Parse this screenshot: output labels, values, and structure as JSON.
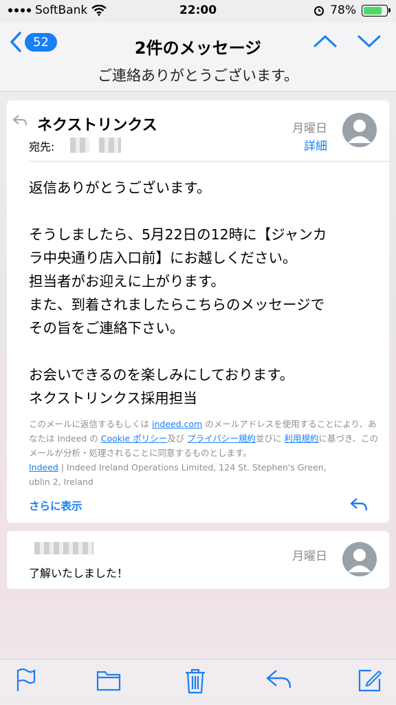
{
  "status": {
    "carrier": "SoftBank",
    "time": "22:00",
    "battery": "78%",
    "battery_level": 0.78
  },
  "nav": {
    "badge": "52",
    "title": "2件のメッセージ",
    "subtitle": "ご連絡ありがとうございます。"
  },
  "message1": {
    "sender": "ネクストリンクス",
    "to_label": "宛先:",
    "date": "月曜日",
    "details": "詳細",
    "body_lines": [
      "返信ありがとうございます。",
      "",
      "そうしましたら、5月22日の12時に【ジャンカ",
      "ラ中央通り店入口前】にお越しください。",
      "担当者がお迎えに上がります。",
      "また、到着されましたらこちらのメッセージで",
      "その旨をご連絡下さい。",
      "",
      "お会いできるのを楽しみにしております。",
      "ネクストリンクス採用担当"
    ],
    "footer": {
      "t1": "このメールに返信するもしくは ",
      "l1": "indeed.com",
      "t2": " のメールアドレスを使用することにより、あなたは Indeed の ",
      "l2": "Cookie ポリシー",
      "t3": "及び ",
      "l3": "プライバシー規約",
      "t4": "並びに ",
      "l4": "利用規約",
      "t5": "に基づき、このメールが分析・処理されることに同意するものとします。",
      "l5": "Indeed",
      "t6": " | Indeed Ireland Operations Limited, 124 St. Stephen's Green,",
      "t7": "ublin 2, Ireland"
    },
    "more": "さらに表示"
  },
  "message2": {
    "date": "月曜日",
    "body": "了解いたしました！"
  },
  "colors": {
    "accent": "#1a7ff3",
    "gray": "#8e8e93"
  }
}
